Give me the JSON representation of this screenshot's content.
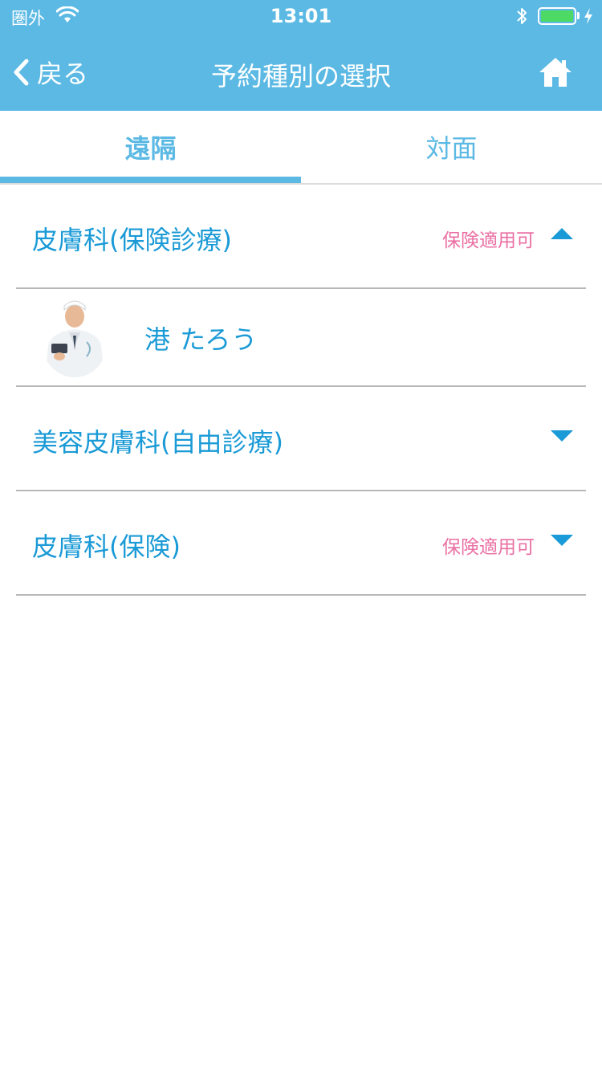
{
  "status_bar": {
    "carrier": "圏外",
    "time": "13:01",
    "battery_level": 1.0
  },
  "nav": {
    "back_label": "戻る",
    "title": "予約種別の選択",
    "home_icon": "home-icon"
  },
  "tabs": [
    {
      "label": "遠隔",
      "selected": true
    },
    {
      "label": "対面",
      "selected": false
    }
  ],
  "categories": [
    {
      "title": "皮膚科(保険診療)",
      "badge": "保険適用可",
      "expanded": true
    },
    {
      "title": "美容皮膚科(自由診療)",
      "badge": "",
      "expanded": false
    },
    {
      "title": "皮膚科(保険)",
      "badge": "保険適用可",
      "expanded": false
    }
  ],
  "doctors": [
    {
      "name": "港 たろう"
    }
  ],
  "colors": {
    "header": "#5bb9e4",
    "text_blue": "#1a9ad6",
    "badge_pink": "#ea6fa3",
    "arrow_blue": "#1a9ad6"
  }
}
